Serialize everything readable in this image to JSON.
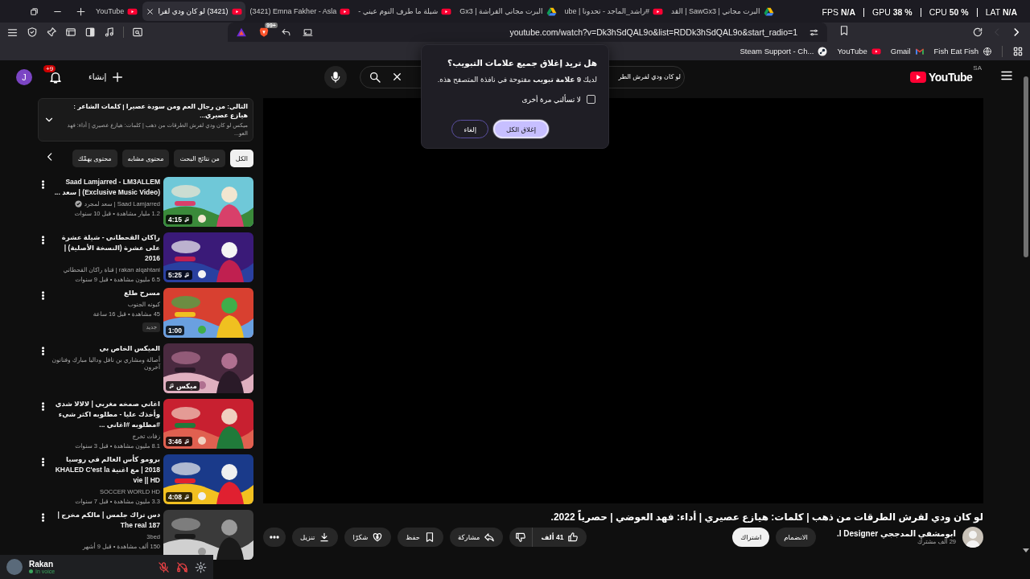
{
  "browser_tabs": [
    {
      "title": "البرت مجاني | SawGx3 | القد",
      "kind": "drive",
      "selected": false
    },
    {
      "title": "#راشد_الماجد - تحدونا | ube",
      "kind": "youtube",
      "selected": false
    },
    {
      "title": "البرت مجاني الفراشة | Gx3",
      "kind": "drive",
      "selected": false
    },
    {
      "title": "شيلة ما طرف النوم عيني -",
      "kind": "youtube",
      "selected": false
    },
    {
      "title": "(3421) Emna Fakher - Asla",
      "kind": "youtube",
      "selected": false
    },
    {
      "title": "(3421) لو كان ودي لفرا",
      "kind": "youtube",
      "selected": true
    },
    {
      "title": "YouTube",
      "kind": "youtube",
      "selected": false
    }
  ],
  "perf_overlay": [
    "LAT **N/A**",
    "CPU **50 %**",
    "GPU **38 %**",
    "FPS **N/A**"
  ],
  "toolbar": {
    "shields_badge": "99+",
    "url": "youtube.com/watch?v=Dk3hSdQAL9o&list=RDDk3hSdQAL9o&start_radio=1"
  },
  "nav": [
    {
      "kind": "back",
      "disabled": false
    },
    {
      "kind": "forward",
      "disabled": true
    }
  ],
  "bookmarks": [
    {
      "label": "Fish Eat Fish",
      "kind": "globe"
    },
    {
      "label": "Gmail",
      "kind": "gmail"
    },
    {
      "label": "YouTube",
      "kind": "youtube"
    },
    {
      "label": "Steam Support - Ch...",
      "kind": "steam"
    }
  ],
  "yt_header": {
    "avatar": "J",
    "notification_count": "+9",
    "create_label": "إنشاء",
    "search_value": "لو كان ودي لفرش الطر",
    "logo_text": "YouTube",
    "logo_region": "SA"
  },
  "up_next": {
    "title": "التالي: من رجال العم ومن سودة عصيرا | كلمات الشاعر : هيازع عصيري...",
    "subtitle": "ميكس لو كان ودي لفرش الطرقات من ذهب | كلمات: هيازع عصيري | أداء: فهد العو..."
  },
  "chips": [
    {
      "label": "الكل",
      "selected": true
    },
    {
      "label": "من نتائج البحث",
      "selected": false
    },
    {
      "label": "محتوى مشابه",
      "selected": false
    },
    {
      "label": "محتوى يهمّك",
      "selected": false
    }
  ],
  "videos": [
    {
      "title": "Saad Lamjarred - LM3ALLEM (Exclusive Music Video) | سعد ...",
      "channel": "Saad Lamjarred | سعد لمجرد",
      "verified": true,
      "meta": "1.2 مليار مشاهدة • قبل 10 سنوات",
      "badge": "4:15",
      "kind": "duration"
    },
    {
      "title": "راكان القحطاني - شيلة عشرة على عشرة (النسخة الأصلية) | 2016",
      "channel": "rakan alqahtani | قناة راكان القحطاني",
      "verified": false,
      "meta": "6.5 مليون مشاهدة • قبل 9 سنوات",
      "badge": "5:25",
      "kind": "duration"
    },
    {
      "title": "مسرح طلع",
      "channel": "كيونه الجنوب",
      "verified": false,
      "meta": "45 مشاهدة • قبل 16 ساعة",
      "new_label": "جديد",
      "badge": "1:00",
      "kind": "plain"
    },
    {
      "title": "الميكس الخاص بي",
      "channel": "أصالة ومشاري بن نافل وداليا مبارك وفنانون آخرون",
      "verified": false,
      "badge": "ميكس",
      "kind": "mix"
    },
    {
      "title": "اغاني صمخه مغربي | لالالا شدي وأخذك عليا - مطلوبه اكثر شيء #مطلوبه #اغاني ...",
      "channel": "زفات تخرج",
      "verified": false,
      "meta": "8.1 مليون مشاهدة • قبل 3 سنوات",
      "badge": "3:46",
      "kind": "duration"
    },
    {
      "title": "برومو كأس العالم في روسيا 2018 | مع اغنية KHALED C'est la vie || HD",
      "channel": "SOCCER WORLD HD",
      "verified": false,
      "meta": "3.3 مليون مشاهدة • قبل 7 سنوات",
      "badge": "4:08",
      "kind": "duration"
    },
    {
      "title": "دس تراك جلمس | مالكم مخرج | The real 187",
      "channel": "3bed",
      "verified": false,
      "meta": "150 ألف مشاهدة • قبل 9 أشهر"
    }
  ],
  "video_title": "لو كان ودي لفرش الطرقات من ذهب | كلمات: هيازع عصيري | أداء: فهد العوضي | حصرياً 2022.",
  "channel": {
    "name": "ابومشقي المدججي I Designer.",
    "subscribers": "29 ألف مشترك",
    "join_label": "الانضمام",
    "subscribe_label": "اشتراك"
  },
  "actions": [
    {
      "kind": "like",
      "label": "41 ألف"
    },
    {
      "kind": "dislike"
    },
    {
      "kind": "share",
      "label": "مشاركة"
    },
    {
      "kind": "save",
      "label": "حفظ"
    },
    {
      "kind": "thanks",
      "label": "شكرًا"
    },
    {
      "kind": "download",
      "label": "تنزيل"
    },
    {
      "kind": "more"
    }
  ],
  "voice": {
    "user": "Rakan",
    "status": "In voice"
  },
  "dialog": {
    "title": "هل تريد إغلاق جميع علامات التبويب؟",
    "message": "لديك **9 علامة تبويب** مفتوحة في نافذة المتصفح هذه.",
    "checkbox_label": "لا تسألني مرة أخرى",
    "checked": false,
    "buttons": [
      {
        "label": "إغلاق الكل",
        "primary": true
      },
      {
        "label": "إلغاء",
        "primary": false
      }
    ]
  }
}
